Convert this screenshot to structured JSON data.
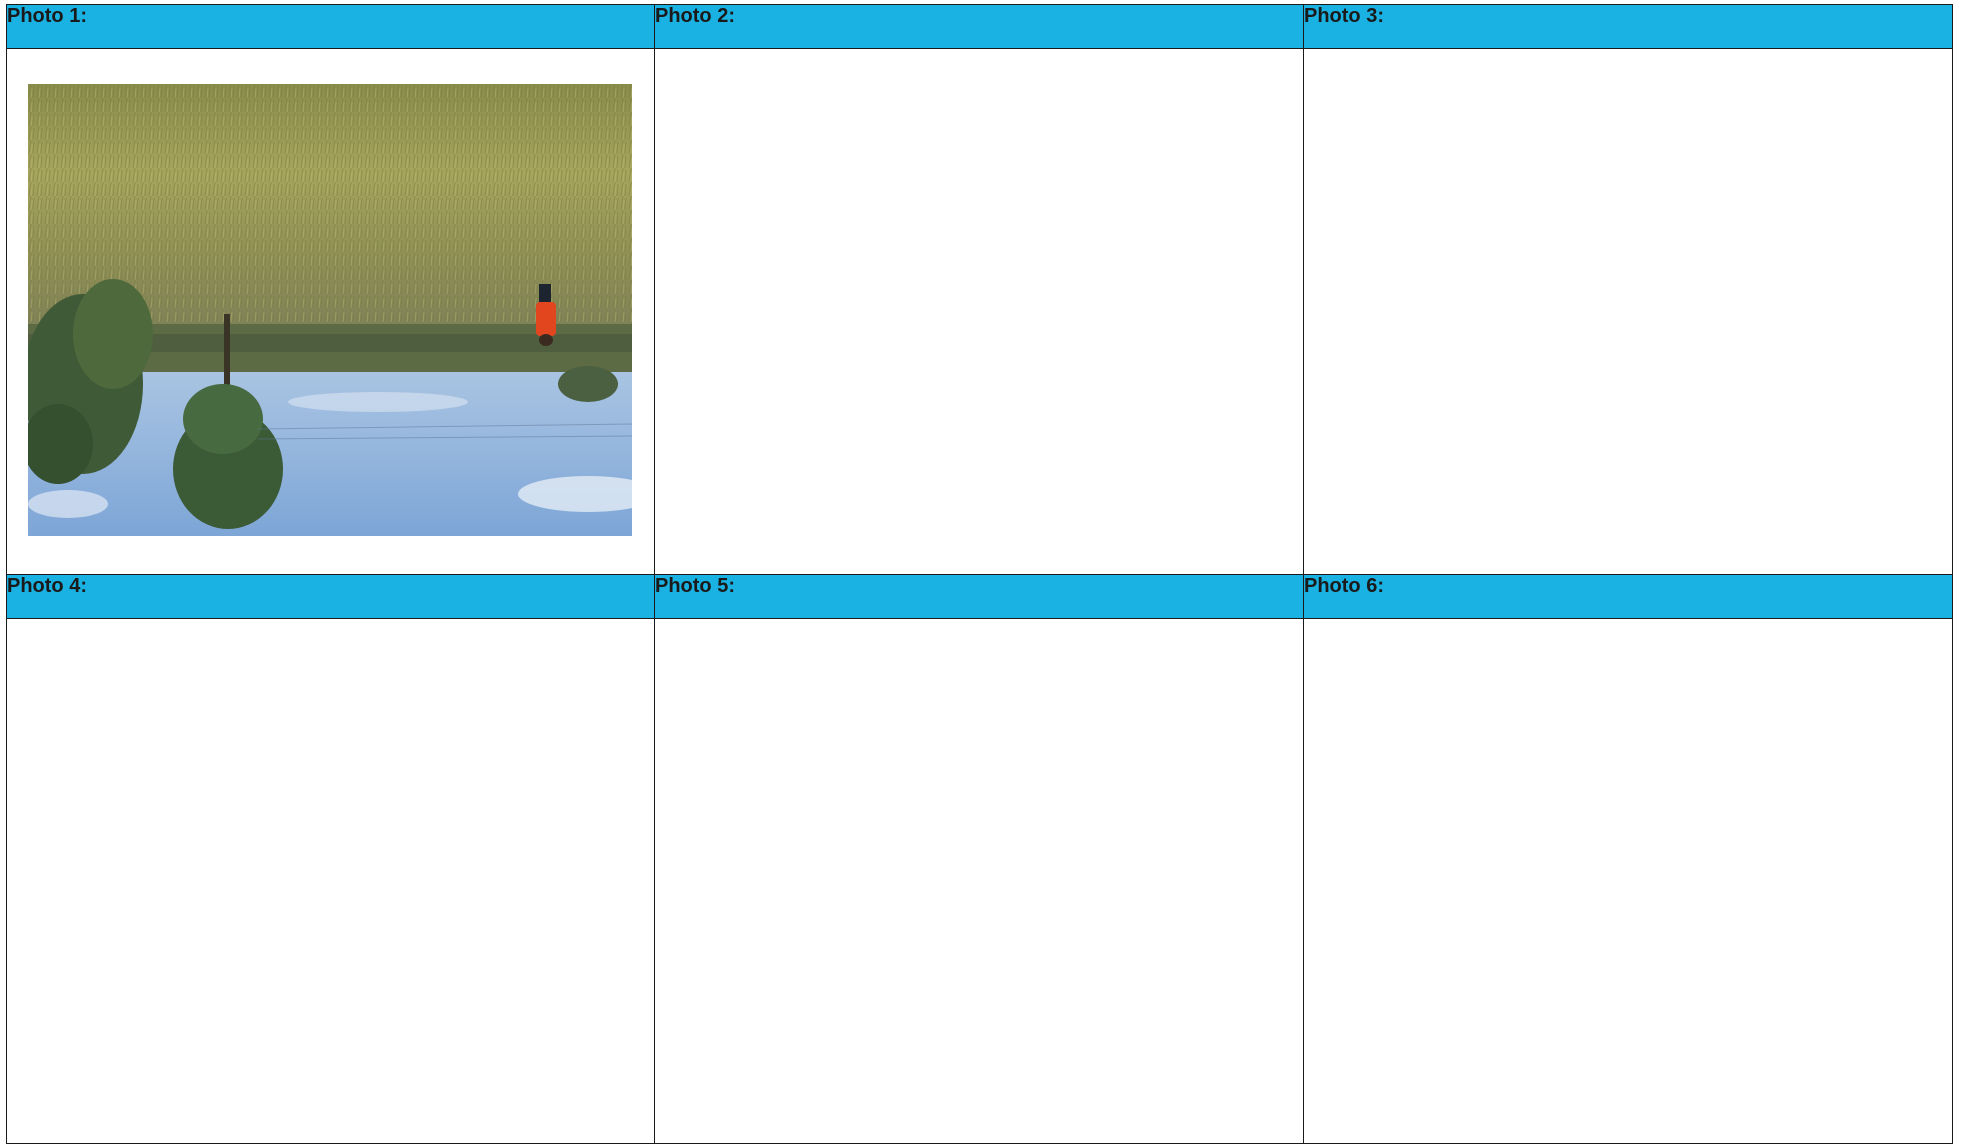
{
  "headers": {
    "photo1": "Photo 1:",
    "photo2": "Photo 2:",
    "photo3": "Photo 3:",
    "photo4": "Photo 4:",
    "photo5": "Photo 5:",
    "photo6": "Photo 6:"
  },
  "colors": {
    "header_bg": "#19b2e3",
    "border": "#1a1a1a"
  }
}
